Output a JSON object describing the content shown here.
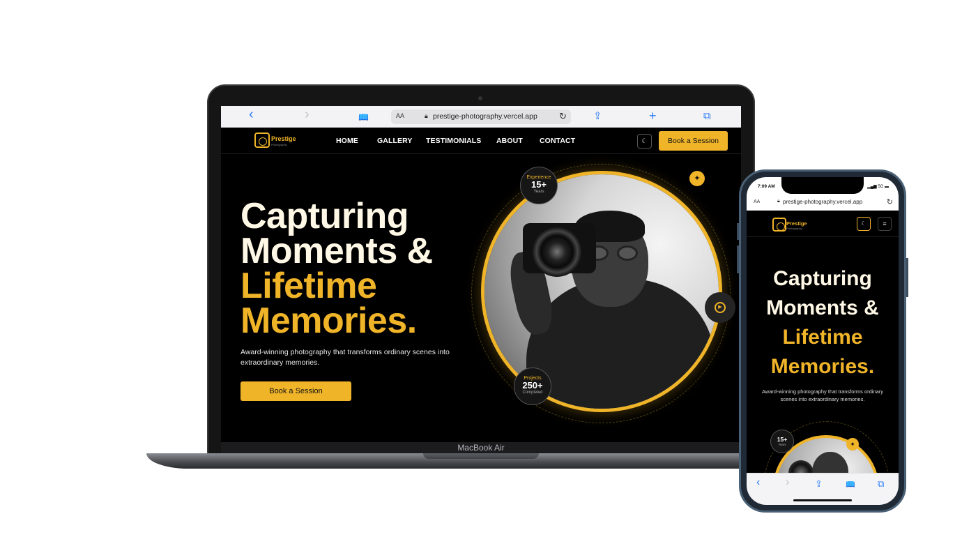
{
  "laptop": {
    "safari": {
      "back_icon": "‹",
      "forward_icon": "›",
      "reader_icon": "📖",
      "aa_label": "AA",
      "url": "prestige-photography.vercel.app",
      "share_icon": "⇪",
      "newtab_icon": "+",
      "tabs_icon": "⧉"
    },
    "logo": {
      "name": "Prestige",
      "tagline": "Photography"
    },
    "nav": {
      "home": "HOME",
      "gallery": "GALLERY",
      "testimonials": "TESTIMONIALS",
      "about": "ABOUT",
      "contact": "CONTACT"
    },
    "theme_icon": "☾",
    "book_label": "Book a Session",
    "hero": {
      "line1": "Capturing",
      "line2": "Moments &",
      "line3": "Lifetime",
      "line4": "Memories.",
      "subtitle": "Award-winning photography that transforms ordinary scenes into extraordinary memories.",
      "cta": "Book a Session"
    },
    "badges": {
      "experience": {
        "top": "Experience",
        "num": "15+",
        "bottom": "Years"
      },
      "projects": {
        "top": "Projects",
        "num": "250+",
        "bottom": "Completed"
      }
    },
    "device_label": "MacBook Air"
  },
  "phone": {
    "status": {
      "time": "7:09 AM",
      "signal": "5G"
    },
    "safari": {
      "aa_label": "AA",
      "url": "prestige-photography.vercel.app"
    },
    "logo": {
      "name": "Prestige",
      "tagline": "Photography"
    },
    "hero": {
      "line1": "Capturing",
      "line2": "Moments &",
      "line3": "Lifetime",
      "line4": "Memories.",
      "subtitle": "Award-winning photography that transforms ordinary scenes into extraordinary memories."
    },
    "badge": {
      "num": "15+",
      "bottom": "Years"
    }
  },
  "colors": {
    "accent": "#f0b429",
    "background": "#000000",
    "safari_blue": "#2a7bf6"
  }
}
